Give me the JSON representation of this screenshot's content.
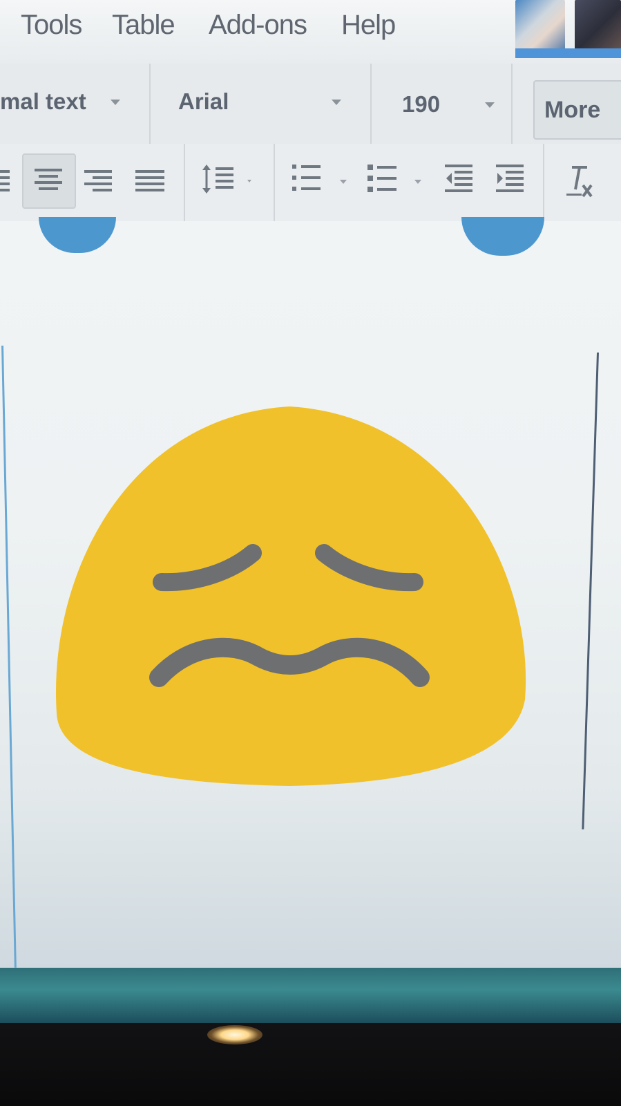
{
  "menubar": {
    "items": [
      "Tools",
      "Table",
      "Add-ons",
      "Help"
    ]
  },
  "toolbar": {
    "style_value": "mal text",
    "font_value": "Arial",
    "size_value": "190",
    "more_label": "More"
  },
  "colors": {
    "emoji_face": "#f1c12b",
    "emoji_features": "#6e6f70",
    "accent": "#4d97cf"
  },
  "emoji": {
    "name": "confounded-face-icon"
  }
}
